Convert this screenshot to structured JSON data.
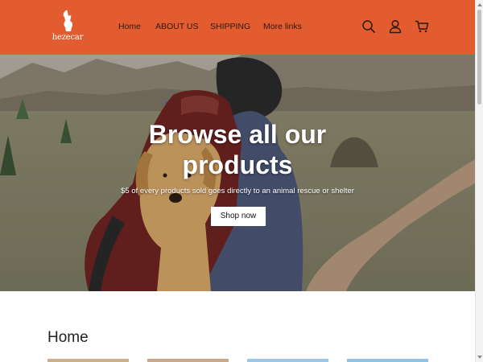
{
  "brand": {
    "logo_text": "hezecar",
    "color": "#e35c2f"
  },
  "nav": {
    "items": [
      {
        "label": "Home"
      },
      {
        "label": "ABOUT US"
      },
      {
        "label": "SHIPPING"
      },
      {
        "label": "More links"
      }
    ]
  },
  "header_icons": [
    "search-icon",
    "account-icon",
    "cart-icon"
  ],
  "hero": {
    "title": "Browse all our products",
    "subtitle": "$5 of every products sold goes directly to an animal rescue or shelter",
    "button_label": "Shop now"
  },
  "section": {
    "title": "Home",
    "cards": [
      {
        "name": "product-card-1",
        "color": "#c9b18a"
      },
      {
        "name": "product-card-2",
        "color": "#c8a98c"
      },
      {
        "name": "product-card-3",
        "color": "#9cc7e6"
      },
      {
        "name": "product-card-4",
        "color": "#8fc3e4"
      }
    ]
  }
}
